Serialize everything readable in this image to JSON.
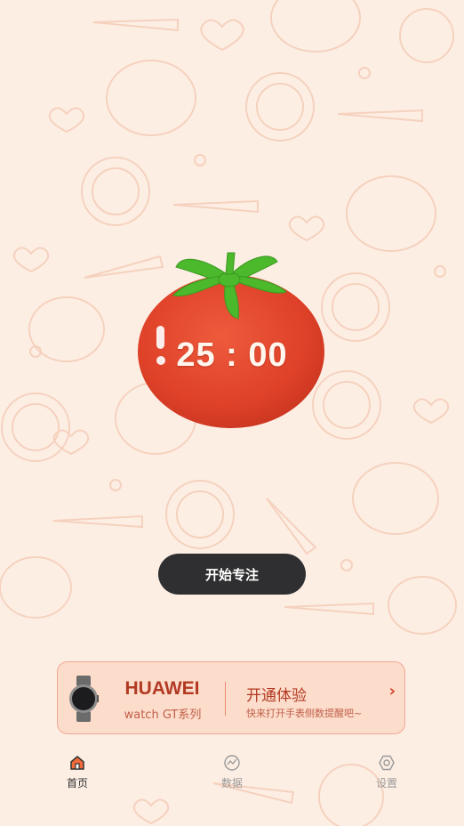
{
  "timer": {
    "display": "25 : 00"
  },
  "start_button": {
    "label": "开始专注"
  },
  "banner": {
    "brand": "HUAWEI",
    "model": "watch GT系列",
    "title": "开通体验",
    "subtitle": "快来打开手表侧数提醒吧~",
    "chevron": "›",
    "accent_color": "#b23a24",
    "background_color": "#fcdcca"
  },
  "tabs": [
    {
      "label": "首页",
      "icon": "home-icon",
      "active": true
    },
    {
      "label": "数据",
      "icon": "chart-icon",
      "active": false
    },
    {
      "label": "设置",
      "icon": "settings-icon",
      "active": false
    }
  ],
  "colors": {
    "background": "#fdeee4",
    "tomato": "#e04a30",
    "leaf": "#4cb82c",
    "button": "#2f2f31"
  }
}
